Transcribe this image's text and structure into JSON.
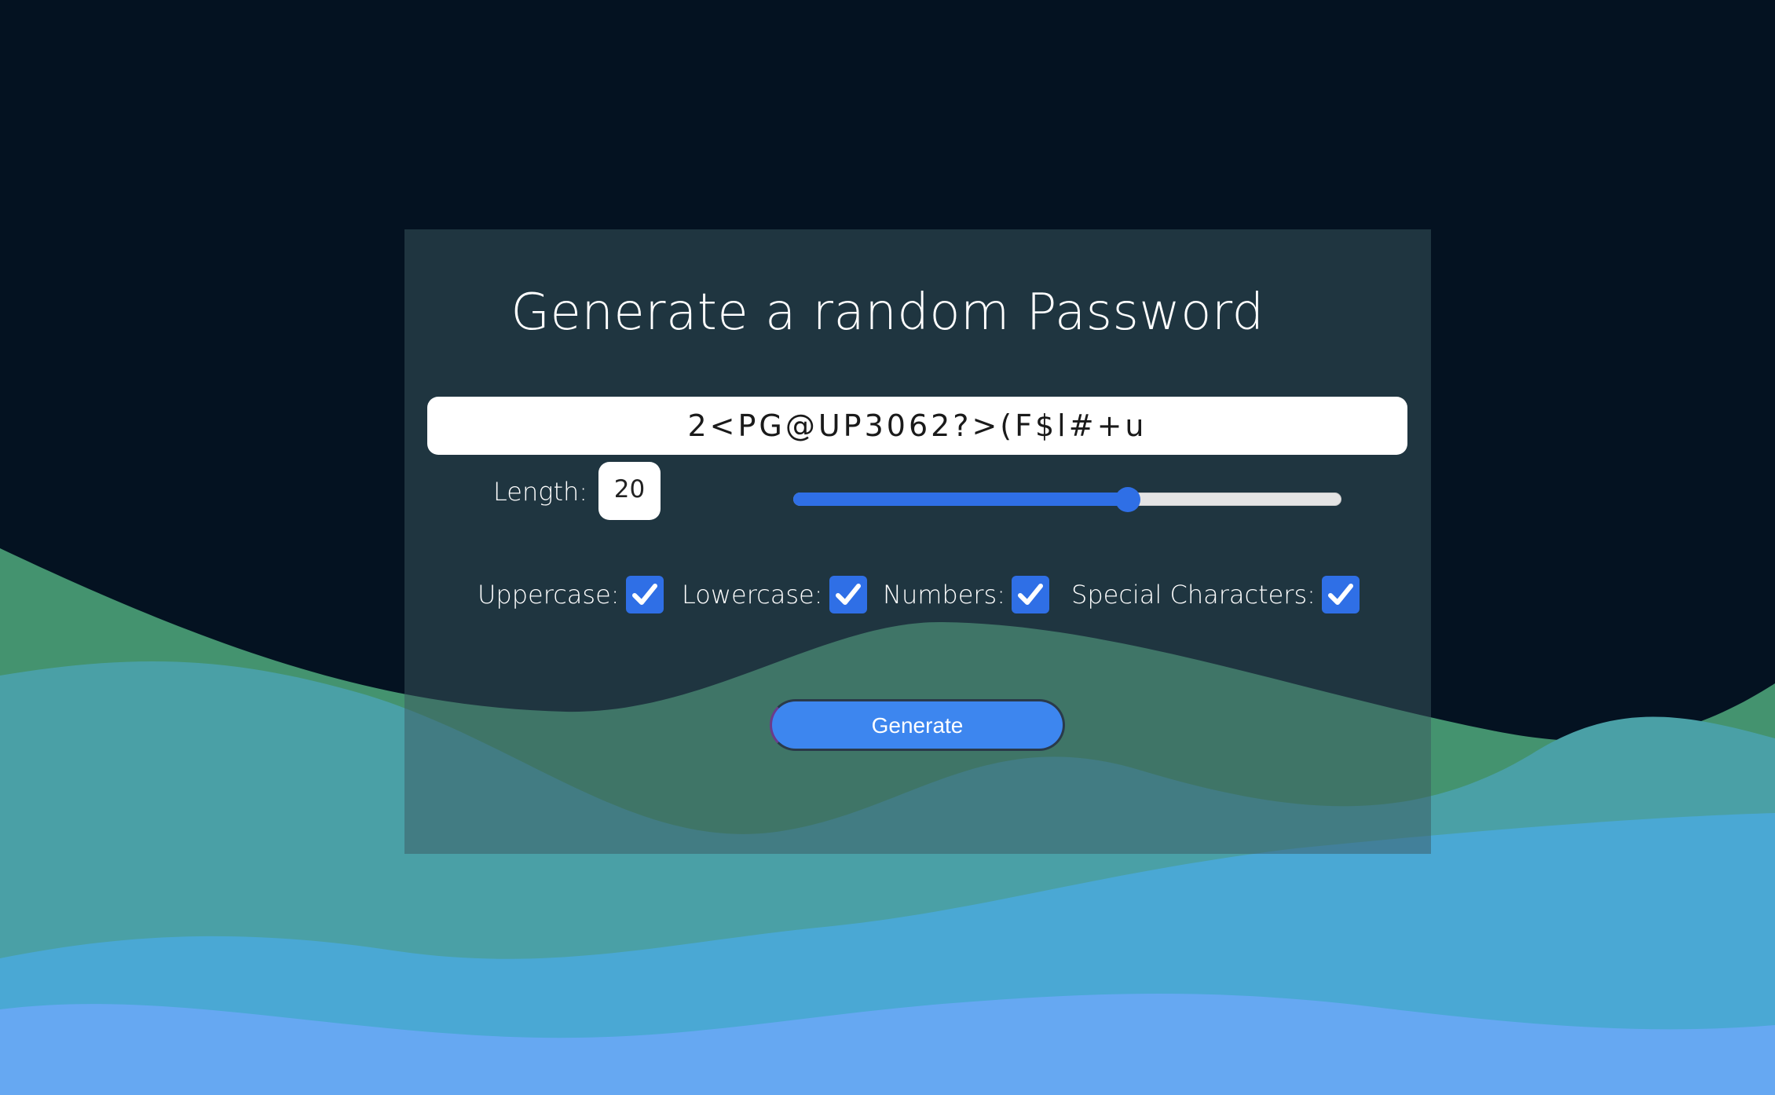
{
  "page": {
    "title": "Generate a random Password"
  },
  "password": {
    "value": "2<PG@UP3062?>(F$l#+u"
  },
  "length": {
    "label": "Length:",
    "value": "20",
    "slider_fraction": 0.61
  },
  "options": [
    {
      "label": "Uppercase:",
      "checked": true
    },
    {
      "label": "Lowercase:",
      "checked": true
    },
    {
      "label": "Numbers:",
      "checked": true
    },
    {
      "label": "Special Characters:",
      "checked": true
    }
  ],
  "generate_button": {
    "label": "Generate"
  },
  "colors": {
    "background": "#041221",
    "accent": "#2f6fe6",
    "button": "#3d86ef",
    "wave_green": "#44936f",
    "wave_teal": "#4aa0a6",
    "wave_blue": "#4aa8d4",
    "wave_light_blue": "#66a8f2"
  }
}
